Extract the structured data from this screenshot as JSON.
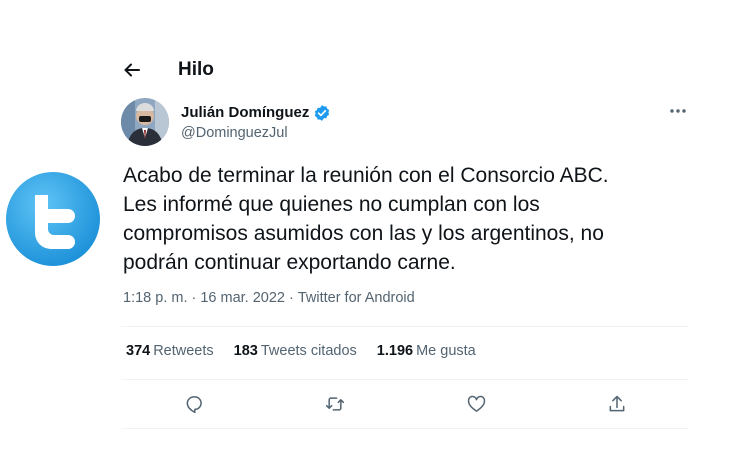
{
  "header": {
    "title": "Hilo",
    "back_icon": "arrow-left-icon"
  },
  "brand": {
    "logo_icon": "twitter-bird-icon",
    "color": "#1da1f2"
  },
  "author": {
    "display_name": "Julián Domínguez",
    "handle": "@DominguezJul",
    "verified": true,
    "verified_color": "#1d9bf0"
  },
  "tweet": {
    "text": "Acabo de terminar la reunión con el Consorcio ABC.\nLes informé que quienes no cumplan con los\ncompromisos asumidos con las y los argentinos, no\npodrán continuar exportando carne.",
    "time": "1:18 p. m.",
    "separator": "·",
    "date": "16 mar. 2022",
    "source": "Twitter for Android"
  },
  "stats": {
    "retweets": {
      "count": "374",
      "label": "Retweets"
    },
    "quotes": {
      "count": "183",
      "label": "Tweets citados"
    },
    "likes": {
      "count": "1.196",
      "label": "Me gusta"
    }
  },
  "actions": [
    "reply-icon",
    "retweet-icon",
    "like-icon",
    "share-icon"
  ],
  "colors": {
    "text": "#0f1419",
    "secondary": "#536471",
    "divider": "#eff3f4"
  }
}
